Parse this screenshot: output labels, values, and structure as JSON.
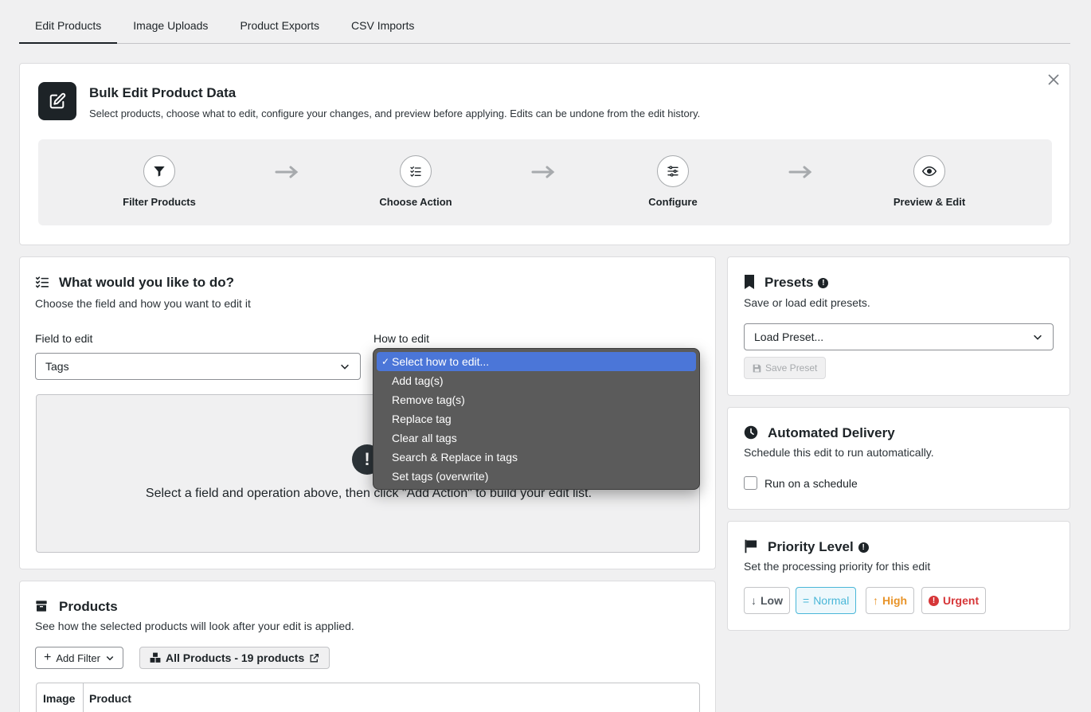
{
  "tabs": [
    {
      "label": "Edit Products",
      "active": true
    },
    {
      "label": "Image Uploads"
    },
    {
      "label": "Product Exports"
    },
    {
      "label": "CSV Imports"
    }
  ],
  "header": {
    "title": "Bulk Edit Product Data",
    "description": "Select products, choose what to edit, configure your changes, and preview before applying. Edits can be undone from the edit history.",
    "steps": [
      {
        "label": "Filter Products",
        "icon": "filter-icon"
      },
      {
        "label": "Choose Action",
        "icon": "checklist-icon"
      },
      {
        "label": "Configure",
        "icon": "sliders-icon"
      },
      {
        "label": "Preview & Edit",
        "icon": "eye-icon"
      }
    ]
  },
  "action": {
    "title": "What would you like to do?",
    "subtitle": "Choose the field and how you want to edit it",
    "field_label": "Field to edit",
    "field_value": "Tags",
    "how_label": "How to edit",
    "how_options": [
      "Select how to edit...",
      "Add tag(s)",
      "Remove tag(s)",
      "Replace tag",
      "Clear all tags",
      "Search & Replace in tags",
      "Set tags (overwrite)"
    ],
    "how_selected": "Select how to edit...",
    "empty_text": "Select a field and operation above, then click \"Add Action\" to build your edit list."
  },
  "products": {
    "title": "Products",
    "subtitle": "See how the selected products will look after your edit is applied.",
    "add_filter": "Add Filter",
    "all_products": "All Products - 19 products",
    "columns": [
      "Image",
      "Product"
    ]
  },
  "presets": {
    "title": "Presets",
    "subtitle": "Save or load edit presets.",
    "load_placeholder": "Load Preset...",
    "save_label": "Save Preset"
  },
  "delivery": {
    "title": "Automated Delivery",
    "subtitle": "Schedule this edit to run automatically.",
    "schedule_label": "Run on a schedule",
    "schedule_checked": false
  },
  "priority": {
    "title": "Priority Level",
    "subtitle": "Set the processing priority for this edit",
    "levels": [
      {
        "label": "Low",
        "color": "#50575e"
      },
      {
        "label": "Normal",
        "color": "#4ab7d8",
        "selected": true
      },
      {
        "label": "High",
        "color": "#e8942a"
      },
      {
        "label": "Urgent",
        "color": "#d63638"
      }
    ]
  },
  "colors": {
    "dropdown_highlight": "#4b76d8",
    "dark": "#1d2327",
    "page_bg": "#f0f0f1"
  }
}
